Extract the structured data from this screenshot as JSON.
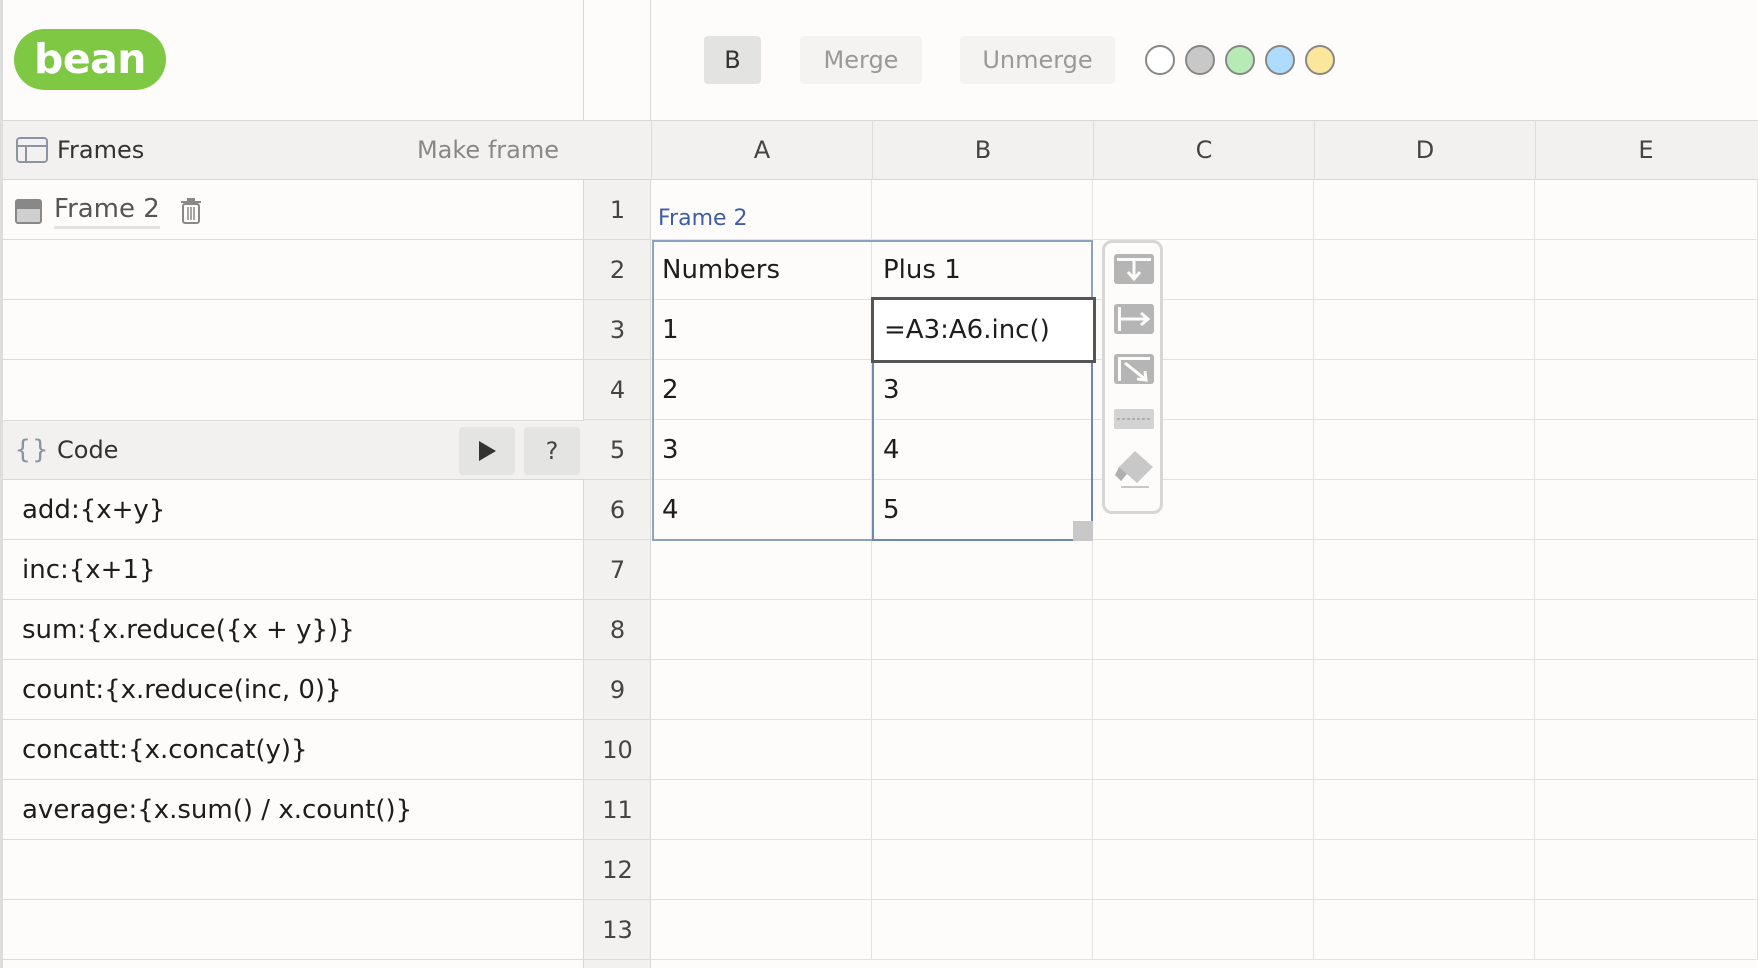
{
  "app": {
    "logo": "bean"
  },
  "toolbar": {
    "bold_label": "B",
    "merge_label": "Merge",
    "unmerge_label": "Unmerge",
    "swatches": [
      "#ffffff",
      "#c8c8c8",
      "#b6ebb6",
      "#aedcff",
      "#fbe69c"
    ]
  },
  "frames_panel": {
    "title": "Frames",
    "make_frame_label": "Make frame",
    "items": [
      {
        "label": "Frame 2"
      }
    ]
  },
  "code_panel": {
    "title": "Code",
    "help_label": "?",
    "lines": [
      "add:{x+y}",
      "inc:{x+1}",
      "sum:{x.reduce({x + y})}",
      "count:{x.reduce(inc, 0)}",
      "concatt:{x.concat(y)}",
      "average:{x.sum() / x.count()}"
    ]
  },
  "grid": {
    "columns": [
      "A",
      "B",
      "C",
      "D",
      "E"
    ],
    "rows": [
      "1",
      "2",
      "3",
      "4",
      "5",
      "6",
      "7",
      "8",
      "9",
      "10",
      "11",
      "12",
      "13"
    ],
    "frame_label": "Frame 2",
    "cells": {
      "A2": "Numbers",
      "B2": "Plus 1",
      "A3": "1",
      "B3": "=A3:A6.inc()",
      "A4": "2",
      "B4": "3",
      "A5": "3",
      "B5": "4",
      "A6": "4",
      "B6": "5"
    }
  }
}
